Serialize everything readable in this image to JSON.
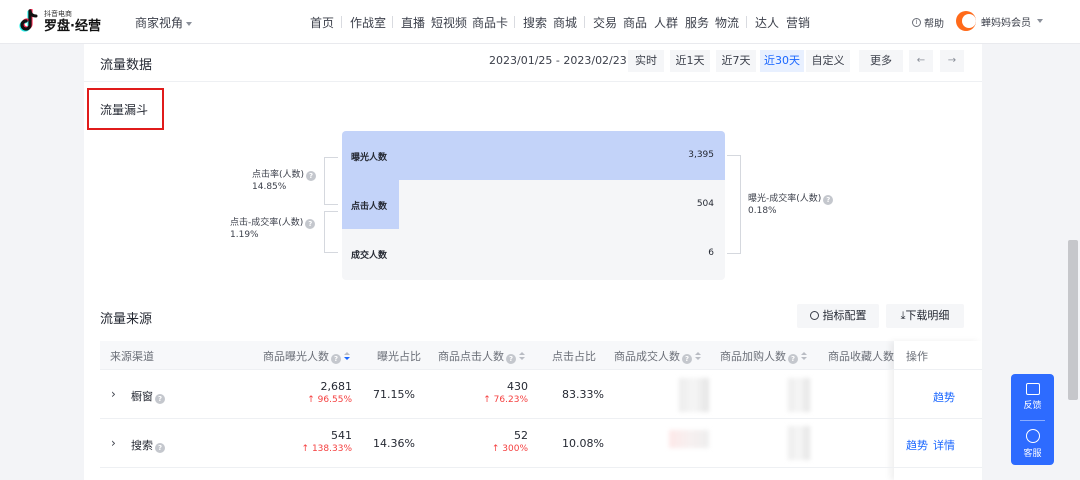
{
  "app": {
    "logo_small": "抖音电商",
    "logo_main": "罗盘·经营",
    "role_label": "商家视角",
    "help_label": "帮助",
    "user_name": "蝉妈妈会员"
  },
  "nav": {
    "items": [
      "首页",
      "作战室",
      "直播",
      "短视频",
      "商品卡",
      "搜索",
      "商城",
      "交易",
      "商品",
      "人群",
      "服务",
      "物流",
      "达人",
      "营销"
    ]
  },
  "traffic_data": {
    "title": "流量数据",
    "date_range": "2023/01/25 - 2023/02/23",
    "periods": [
      "实时",
      "近1天",
      "近7天",
      "近30天",
      "自定义"
    ],
    "active_period": "近30天",
    "more_label": "更多",
    "prev_label": "←",
    "next_label": "→"
  },
  "funnel": {
    "title": "流量漏斗",
    "stages": [
      {
        "label": "曝光人数",
        "value": "3,395",
        "fill": 1.0
      },
      {
        "label": "点击人数",
        "value": "504",
        "fill": 0.148
      },
      {
        "label": "成交人数",
        "value": "6",
        "fill": 0.0
      }
    ],
    "click_rate": {
      "label": "点击率(人数)",
      "value": "14.85%"
    },
    "click_conversion": {
      "label": "点击-成交率(人数)",
      "value": "1.19%"
    },
    "exposure_conversion": {
      "label": "曝光-成交率(人数)",
      "value": "0.18%"
    }
  },
  "traffic_source": {
    "title": "流量来源",
    "config_label": "指标配置",
    "download_label": "下载明细",
    "columns": [
      "来源渠道",
      "商品曝光人数",
      "曝光占比",
      "商品点击人数",
      "点击占比",
      "商品成交人数",
      "商品加购人数",
      "商品收藏人数",
      "操作"
    ],
    "rows": [
      {
        "channel": "橱窗",
        "exposure": "2,681",
        "exposure_delta": "↑ 96.55%",
        "exposure_share": "71.15%",
        "clicks": "430",
        "clicks_delta": "↑ 76.23%",
        "click_share": "83.33%",
        "ops": [
          "趋势"
        ]
      },
      {
        "channel": "搜索",
        "exposure": "541",
        "exposure_delta": "↑ 138.33%",
        "exposure_share": "14.36%",
        "clicks": "52",
        "clicks_delta": "↑ 300%",
        "click_share": "10.08%",
        "ops": [
          "趋势",
          "详情"
        ]
      }
    ]
  },
  "side_widget": {
    "feedback_label": "反馈",
    "service_label": "客服"
  },
  "colors": {
    "accent": "#1966ff",
    "funnel_bar": "#c3d3f9",
    "highlight_border": "#e01b1b",
    "up_delta": "#f53f3f",
    "float_panel": "#2d6bff"
  }
}
